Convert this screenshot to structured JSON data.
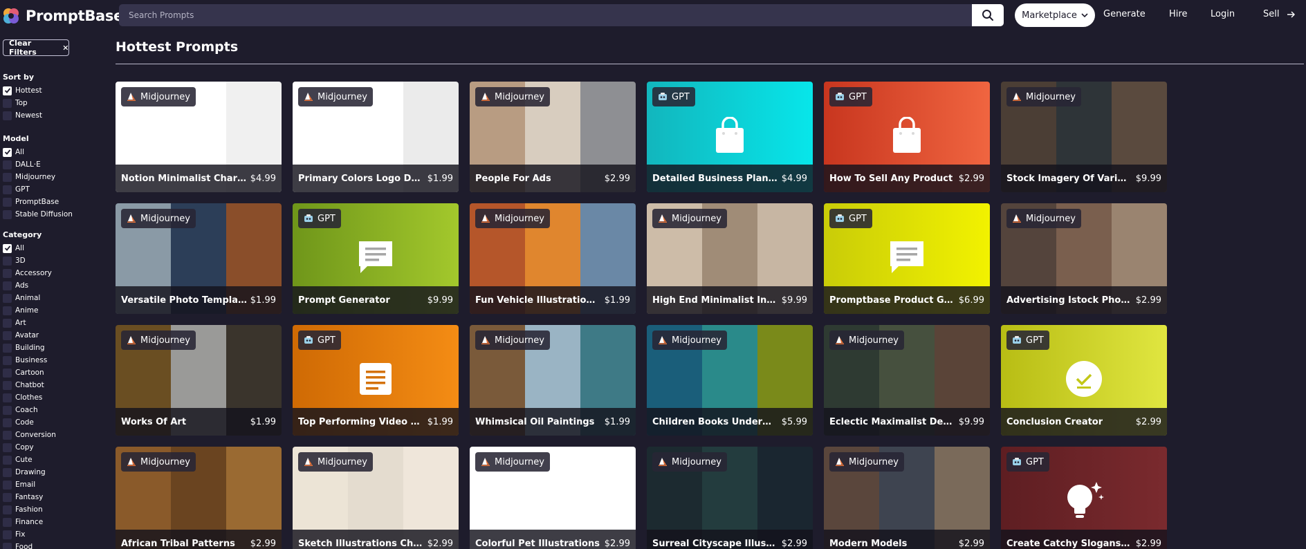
{
  "header": {
    "logo_text": "PromptBase",
    "search_placeholder": "Search Prompts",
    "marketplace_label": "Marketplace",
    "nav": [
      "Generate",
      "Hire",
      "Login",
      "Sell"
    ]
  },
  "sidebar": {
    "clear_label": "Clear Filters",
    "sections": [
      {
        "title": "Sort by",
        "options": [
          {
            "label": "Hottest",
            "checked": true
          },
          {
            "label": "Top",
            "checked": false
          },
          {
            "label": "Newest",
            "checked": false
          }
        ]
      },
      {
        "title": "Model",
        "options": [
          {
            "label": "All",
            "checked": true
          },
          {
            "label": "DALL·E",
            "checked": false
          },
          {
            "label": "Midjourney",
            "checked": false
          },
          {
            "label": "GPT",
            "checked": false
          },
          {
            "label": "PromptBase",
            "checked": false
          },
          {
            "label": "Stable Diffusion",
            "checked": false
          }
        ]
      },
      {
        "title": "Category",
        "options": [
          {
            "label": "All",
            "checked": true
          },
          {
            "label": "3D",
            "checked": false
          },
          {
            "label": "Accessory",
            "checked": false
          },
          {
            "label": "Ads",
            "checked": false
          },
          {
            "label": "Animal",
            "checked": false
          },
          {
            "label": "Anime",
            "checked": false
          },
          {
            "label": "Art",
            "checked": false
          },
          {
            "label": "Avatar",
            "checked": false
          },
          {
            "label": "Building",
            "checked": false
          },
          {
            "label": "Business",
            "checked": false
          },
          {
            "label": "Cartoon",
            "checked": false
          },
          {
            "label": "Chatbot",
            "checked": false
          },
          {
            "label": "Clothes",
            "checked": false
          },
          {
            "label": "Coach",
            "checked": false
          },
          {
            "label": "Code",
            "checked": false
          },
          {
            "label": "Conversion",
            "checked": false
          },
          {
            "label": "Copy",
            "checked": false
          },
          {
            "label": "Cute",
            "checked": false
          },
          {
            "label": "Drawing",
            "checked": false
          },
          {
            "label": "Email",
            "checked": false
          },
          {
            "label": "Fantasy",
            "checked": false
          },
          {
            "label": "Fashion",
            "checked": false
          },
          {
            "label": "Finance",
            "checked": false
          },
          {
            "label": "Fix",
            "checked": false
          },
          {
            "label": "Food",
            "checked": false
          }
        ]
      }
    ]
  },
  "main": {
    "title": "Hottest Prompts",
    "cards": [
      {
        "model": "Midjourney",
        "title": "Notion Minimalist Characters",
        "price": "$4.99",
        "bg": "#f4f4f4",
        "panels": [
          "#ffffff",
          "#ffffff",
          "#f0f0f0"
        ],
        "icon": ""
      },
      {
        "model": "Midjourney",
        "title": "Primary Colors Logo Designs",
        "price": "$1.99",
        "bg": "#fafafa",
        "panels": [
          "#ffffff",
          "#ffffff",
          "#ebebeb"
        ],
        "icon": ""
      },
      {
        "model": "Midjourney",
        "title": "People For Ads",
        "price": "$2.99",
        "bg": "#9c8c7c",
        "panels": [
          "#b89c82",
          "#d8cdbf",
          "#8e8f93"
        ],
        "icon": ""
      },
      {
        "model": "GPT",
        "title": "Detailed Business Plan Model...",
        "price": "$4.99",
        "bg": "#13c8cc",
        "gradient": "linear-gradient(90deg,#12b6bd,#07e6ea)",
        "icon": "bag-icon"
      },
      {
        "model": "GPT",
        "title": "How To Sell Any Product",
        "price": "$2.99",
        "bg": "#d9462c",
        "gradient": "linear-gradient(90deg,#c8361f,#f06540)",
        "icon": "bag-icon"
      },
      {
        "model": "Midjourney",
        "title": "Stock Imagery Of Various Life...",
        "price": "$9.99",
        "bg": "#3a3430",
        "panels": [
          "#4b3e35",
          "#2e3438",
          "#5a4a3e"
        ],
        "icon": ""
      },
      {
        "model": "Midjourney",
        "title": "Versatile Photo Templates",
        "price": "$1.99",
        "bg": "#5a6a78",
        "panels": [
          "#8a9aa6",
          "#2c3e58",
          "#8a4e2a"
        ],
        "icon": ""
      },
      {
        "model": "GPT",
        "title": "Prompt Generator",
        "price": "$9.99",
        "bg": "#7ea21a",
        "gradient": "linear-gradient(90deg,#6f961a,#a3c82c)",
        "icon": "chat-icon"
      },
      {
        "model": "Midjourney",
        "title": "Fun Vehicle Illustrations For ...",
        "price": "$1.99",
        "bg": "#c26a2c",
        "panels": [
          "#b5562a",
          "#e0862e",
          "#6a88a6"
        ],
        "icon": ""
      },
      {
        "model": "Midjourney",
        "title": "High End Minimalist Interiors",
        "price": "$9.99",
        "bg": "#b8a794",
        "panels": [
          "#cdbca8",
          "#a08c77",
          "#c7b6a3"
        ],
        "icon": ""
      },
      {
        "model": "GPT",
        "title": "Promptbase Product Generator",
        "price": "$6.99",
        "bg": "#dcdc06",
        "gradient": "linear-gradient(90deg,#c9cc08,#f2f200)",
        "icon": "chat-icon"
      },
      {
        "model": "Midjourney",
        "title": "Advertising Istock Photos",
        "price": "$2.99",
        "bg": "#6a5446",
        "panels": [
          "#54443c",
          "#7a5f4e",
          "#9a8470"
        ],
        "icon": ""
      },
      {
        "model": "Midjourney",
        "title": "Works Of Art",
        "price": "$1.99",
        "bg": "#4a3e30",
        "panels": [
          "#6a4e22",
          "#9a9a98",
          "#3a342c"
        ],
        "icon": ""
      },
      {
        "model": "GPT",
        "title": "Top Performing Video Topics ...",
        "price": "$1.99",
        "bg": "#e07a0a",
        "gradient": "linear-gradient(90deg,#cf6a04,#f48c14)",
        "icon": "doc-icon"
      },
      {
        "model": "Midjourney",
        "title": "Whimsical Oil Paintings",
        "price": "$1.99",
        "bg": "#6a7a86",
        "panels": [
          "#7a5a3a",
          "#9ab4c4",
          "#3e7a86"
        ],
        "icon": ""
      },
      {
        "model": "Midjourney",
        "title": "Children Books Underwater Sc...",
        "price": "$5.99",
        "bg": "#1e6a7a",
        "panels": [
          "#1a5e7a",
          "#2a8a8a",
          "#7a8a1a"
        ],
        "icon": ""
      },
      {
        "model": "Midjourney",
        "title": "Eclectic Maximalist Decors",
        "price": "$9.99",
        "bg": "#3e4038",
        "panels": [
          "#2e3a32",
          "#46503e",
          "#5a4438"
        ],
        "icon": ""
      },
      {
        "model": "GPT",
        "title": "Conclusion Creator",
        "price": "$2.99",
        "bg": "#c7cc1c",
        "gradient": "linear-gradient(90deg,#b8bd14,#e0e640)",
        "icon": "check-icon"
      },
      {
        "model": "Midjourney",
        "title": "African Tribal Patterns",
        "price": "$2.99",
        "bg": "#7a5026",
        "panels": [
          "#8a5a2a",
          "#6a4420",
          "#9a6a32"
        ],
        "icon": ""
      },
      {
        "model": "Midjourney",
        "title": "Sketch Illustrations Character...",
        "price": "$2.99",
        "bg": "#e8e0d4",
        "panels": [
          "#ece4d6",
          "#e4dccf",
          "#efe6da"
        ],
        "icon": ""
      },
      {
        "model": "Midjourney",
        "title": "Colorful Pet Illustrations",
        "price": "$2.99",
        "bg": "#ffffff",
        "panels": [
          "#ffffff",
          "#ffffff",
          "#ffffff"
        ],
        "icon": ""
      },
      {
        "model": "Midjourney",
        "title": "Surreal Cityscape Illustrations",
        "price": "$2.99",
        "bg": "#1e2a30",
        "panels": [
          "#1c2a30",
          "#233c3e",
          "#1a2630"
        ],
        "icon": ""
      },
      {
        "model": "Midjourney",
        "title": "Modern Models",
        "price": "$2.99",
        "bg": "#4a3e3a",
        "panels": [
          "#5a463c",
          "#3e4450",
          "#7a6a5a"
        ],
        "icon": ""
      },
      {
        "model": "GPT",
        "title": "Create Catchy Slogans For You...",
        "price": "$2.99",
        "bg": "#6a2226",
        "gradient": "linear-gradient(90deg,#5e1e22,#7a2a2e)",
        "icon": "bulb-icon"
      }
    ]
  }
}
